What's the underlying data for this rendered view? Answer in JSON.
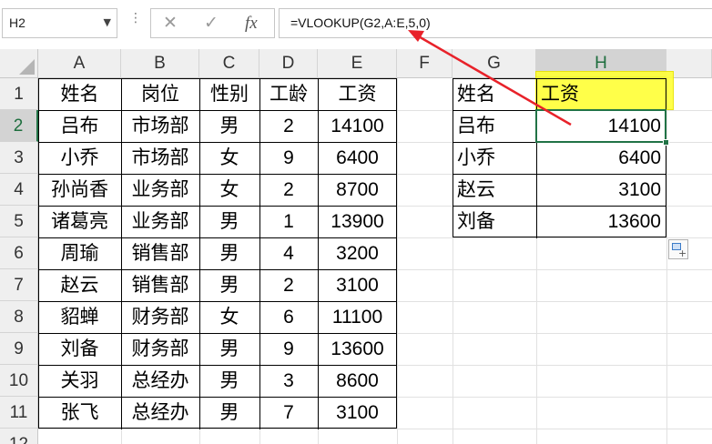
{
  "formula_bar": {
    "name_box": "H2",
    "cancel_symbol": "✕",
    "enter_symbol": "✓",
    "fx_label": "fx",
    "formula": "=VLOOKUP(G2,A:E,5,0)"
  },
  "columns": [
    "A",
    "B",
    "C",
    "D",
    "E",
    "F",
    "G",
    "H"
  ],
  "rows": [
    "1",
    "2",
    "3",
    "4",
    "5",
    "6",
    "7",
    "8",
    "9",
    "10",
    "11",
    "12"
  ],
  "table1": {
    "headers": [
      "姓名",
      "岗位",
      "性别",
      "工龄",
      "工资"
    ],
    "rows": [
      [
        "吕布",
        "市场部",
        "男",
        "2",
        "14100"
      ],
      [
        "小乔",
        "市场部",
        "女",
        "9",
        "6400"
      ],
      [
        "孙尚香",
        "业务部",
        "女",
        "2",
        "8700"
      ],
      [
        "诸葛亮",
        "业务部",
        "男",
        "1",
        "13900"
      ],
      [
        "周瑜",
        "销售部",
        "男",
        "4",
        "3200"
      ],
      [
        "赵云",
        "销售部",
        "男",
        "2",
        "3100"
      ],
      [
        "貂蝉",
        "财务部",
        "女",
        "6",
        "11100"
      ],
      [
        "刘备",
        "财务部",
        "男",
        "9",
        "13600"
      ],
      [
        "关羽",
        "总经办",
        "男",
        "3",
        "8600"
      ],
      [
        "张飞",
        "总经办",
        "男",
        "7",
        "3100"
      ]
    ]
  },
  "table2": {
    "headers": [
      "姓名",
      "工资"
    ],
    "rows": [
      [
        "吕布",
        "14100"
      ],
      [
        "小乔",
        "6400"
      ],
      [
        "赵云",
        "3100"
      ],
      [
        "刘备",
        "13600"
      ]
    ]
  },
  "colors": {
    "highlight": "#ffff3a",
    "selection": "#217346",
    "arrow": "#e8222a"
  }
}
